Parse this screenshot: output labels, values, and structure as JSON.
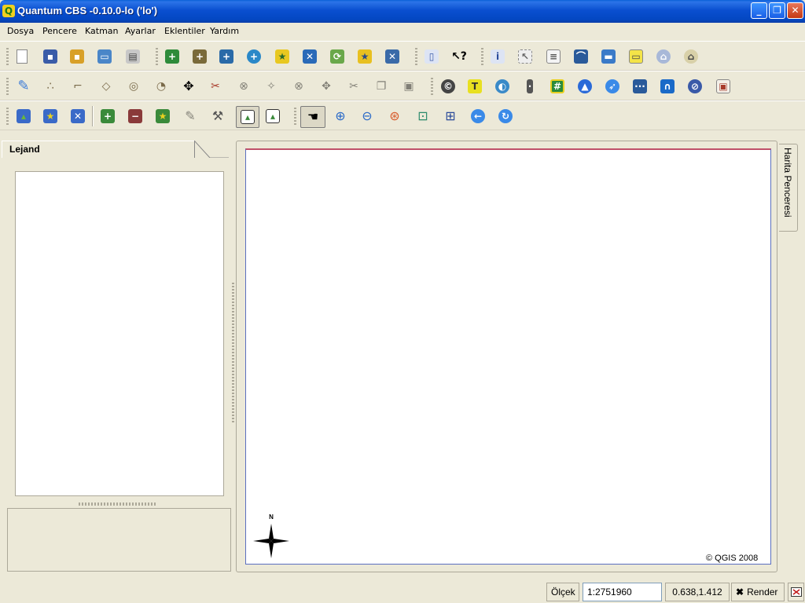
{
  "window": {
    "title": "Quantum CBS -0.10.0-lo ('lo')"
  },
  "menu": [
    "Dosya",
    "Pencere",
    "Katman",
    "Ayarlar",
    "Eklentiler",
    "Yardım"
  ],
  "colors": {
    "titlebar": "#0a4fd0",
    "chrome": "#ece9d8",
    "canvas_border": "#5b6fc0"
  },
  "toolbars": {
    "file": [
      "new-project-icon",
      "save-project-icon",
      "save-as-icon",
      "open-project-icon",
      "print-icon"
    ],
    "layers": [
      "add-vector-layer-icon",
      "add-raster-layer-icon",
      "add-postgis-layer-icon",
      "add-wms-layer-icon",
      "show-all-layers-icon",
      "remove-layer-icon",
      "layer-refresh-icon",
      "add-layer-star-icon",
      "hide-layer-icon"
    ],
    "help": [
      "help-book-icon",
      "whats-this-icon"
    ],
    "attributes": [
      "identify-icon",
      "select-icon",
      "attribute-table-icon",
      "measure-line-icon",
      "measure-area-icon",
      "map-tips-icon",
      "bookmark-icon",
      "new-bookmark-icon"
    ],
    "digitizing": [
      "toggle-editing-icon",
      "capture-point-icon",
      "capture-line-icon",
      "capture-polygon-icon",
      "add-ring-icon",
      "add-island-icon",
      "move-feature-icon",
      "split-feature-icon",
      "delete-selected-icon",
      "add-vertex-icon",
      "delete-vertex-icon",
      "move-vertex-icon",
      "cut-features-icon",
      "copy-features-icon",
      "paste-features-icon"
    ],
    "plugins": [
      "copyright-label-icon",
      "delimited-text-icon",
      "georeferencer-icon",
      "gps-icon",
      "graticule-icon",
      "north-arrow-icon",
      "scalebar-icon",
      "spit-icon",
      "wfs-icon",
      "quick-print-icon",
      "grass-icon"
    ],
    "view": [
      "show-all-icon",
      "show-layer-star-icon",
      "hide-all-icon",
      "add-all-icon",
      "remove-all-icon",
      "show-star-icon",
      "overview-pencil-icon",
      "hammer-icon",
      "in-overview-icon",
      "remove-overview-icon"
    ],
    "navigation": [
      "pan-icon",
      "zoom-in-icon",
      "zoom-out-icon",
      "zoom-full-icon",
      "zoom-to-selection-icon",
      "zoom-to-layer-icon",
      "zoom-last-icon",
      "refresh-icon"
    ]
  },
  "legend": {
    "title": "Lejand"
  },
  "map": {
    "side_tab": "Harita Penceresi",
    "copyright": "© QGIS 2008",
    "north_label": "N"
  },
  "status": {
    "scale_label": "Ölçek",
    "scale_value": "1:2751960",
    "coords": "0.638,1.412",
    "render_label": "Render"
  }
}
